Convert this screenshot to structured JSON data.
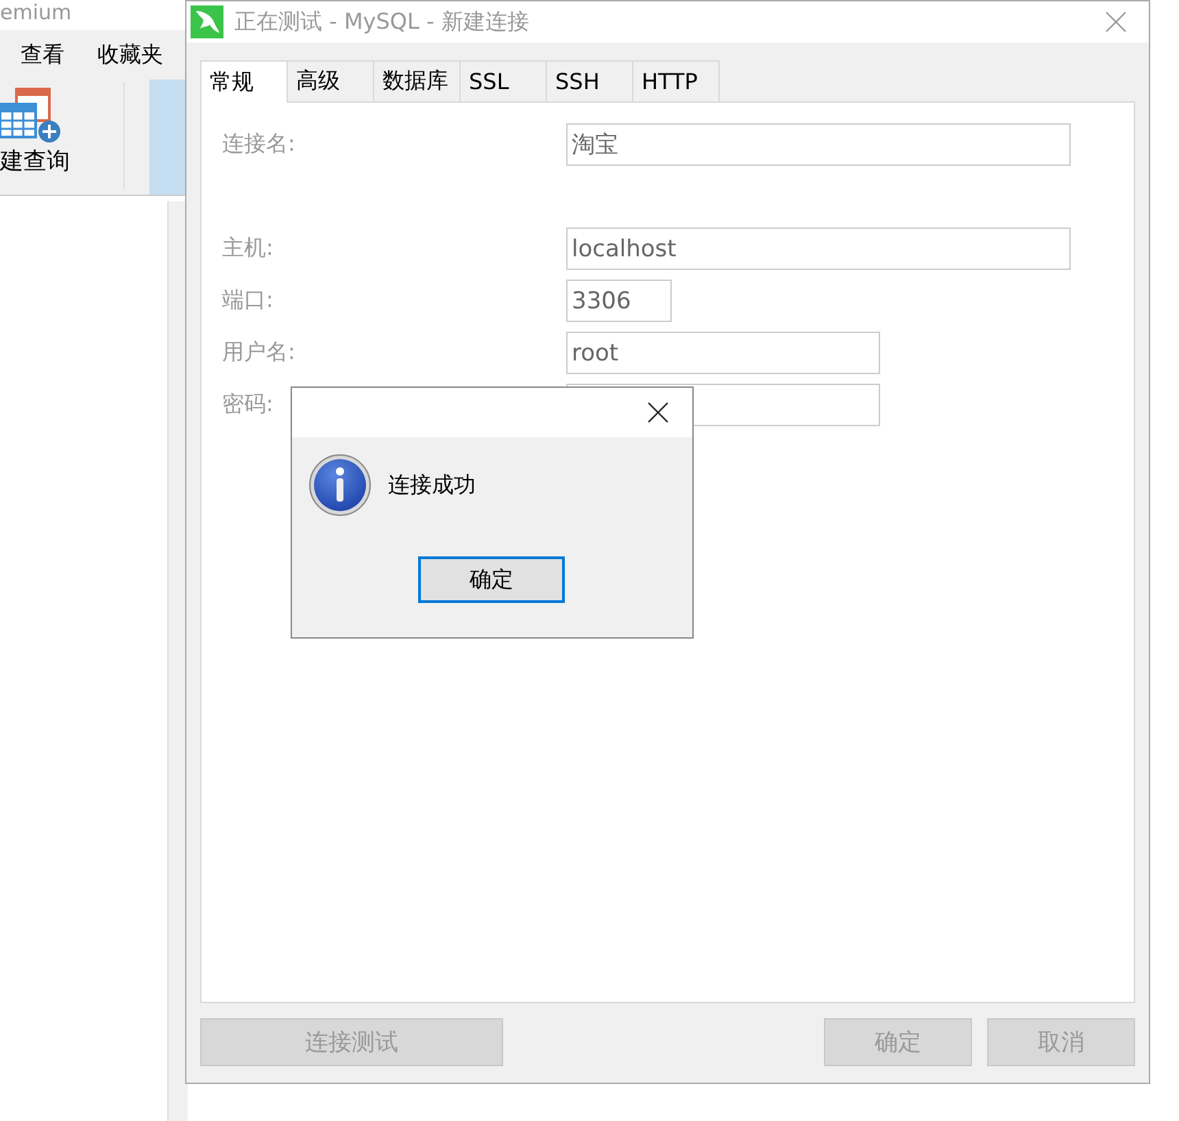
{
  "background_app": {
    "title": "emium",
    "menu": [
      "查看",
      "收藏夹"
    ],
    "toolbar": [
      {
        "kind": "labeled",
        "label": "建查询",
        "selected": false
      },
      {
        "kind": "blank",
        "selected": true
      }
    ]
  },
  "dialog": {
    "title": "正在测试 - MySQL - 新建连接",
    "tabs": [
      {
        "label": "常规",
        "selected": true
      },
      {
        "label": "高级",
        "selected": false
      },
      {
        "label": "数据库",
        "selected": false
      },
      {
        "label": "SSL",
        "selected": false
      },
      {
        "label": "SSH",
        "selected": false
      },
      {
        "label": "HTTP",
        "selected": false
      }
    ],
    "fields": [
      {
        "label": "连接名:",
        "value": "淘宝"
      },
      {
        "label": "主机:",
        "value": "localhost"
      },
      {
        "label": "端口:",
        "value": "3306"
      },
      {
        "label": "用户名:",
        "value": "root"
      },
      {
        "label": "密码:"
      }
    ],
    "buttons": [
      {
        "label": "连接测试",
        "disabled": true
      },
      {
        "label": "确定",
        "disabled": true
      },
      {
        "label": "取消",
        "disabled": true
      }
    ]
  },
  "message_box": {
    "message": "连接成功",
    "button": "确定"
  }
}
